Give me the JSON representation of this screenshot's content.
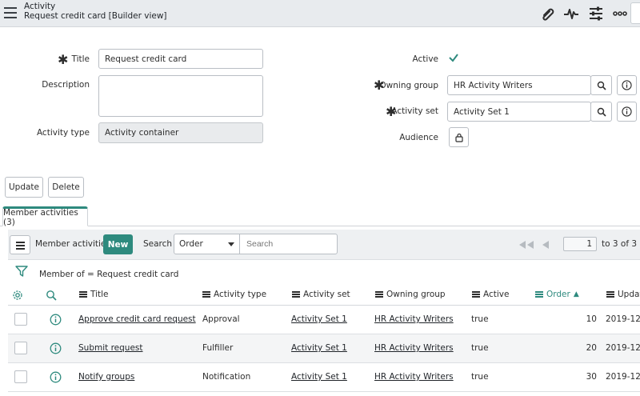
{
  "header": {
    "title": "Activity",
    "subtitle": "Request credit card [Builder view]",
    "icons": [
      "paperclip-icon",
      "activity-pulse-icon",
      "sliders-icon",
      "more-icon"
    ]
  },
  "form": {
    "title_label": "Title",
    "title_value": "Request credit card",
    "description_label": "Description",
    "description_value": "",
    "activity_type_label": "Activity type",
    "activity_type_value": "Activity container",
    "active_label": "Active",
    "active_checked": true,
    "owning_group_label": "Owning group",
    "owning_group_value": "HR Activity Writers",
    "activity_set_label": "Activity set",
    "activity_set_value": "Activity Set 1",
    "audience_label": "Audience"
  },
  "actions": {
    "update_label": "Update",
    "delete_label": "Delete"
  },
  "tabs": [
    {
      "label": "Member activities (3)",
      "active": true
    }
  ],
  "list": {
    "title": "Member activities",
    "new_label": "New",
    "search_label": "Search",
    "search_field": "Order",
    "search_placeholder": "Search",
    "page_current": "1",
    "page_of": "to 3 of 3",
    "filter_text": "Member of = Request credit card",
    "columns": {
      "title": "Title",
      "activity_type": "Activity type",
      "activity_set": "Activity set",
      "owning_group": "Owning group",
      "active": "Active",
      "order": "Order",
      "updated": "Updat"
    },
    "rows": [
      {
        "title": "Approve credit card request",
        "activity_type": "Approval",
        "activity_set": "Activity Set 1",
        "owning_group": "HR Activity Writers",
        "active": "true",
        "order": "10",
        "updated": "2019-12-1"
      },
      {
        "title": "Submit request",
        "activity_type": "Fulfiller",
        "activity_set": "Activity Set 1",
        "owning_group": "HR Activity Writers",
        "active": "true",
        "order": "20",
        "updated": "2019-12-1"
      },
      {
        "title": "Notify groups",
        "activity_type": "Notification",
        "activity_set": "Activity Set 1",
        "owning_group": "HR Activity Writers",
        "active": "true",
        "order": "30",
        "updated": "2019-12-1"
      }
    ]
  },
  "colors": {
    "accent": "#2e8a7e",
    "header_bg": "#e8ebee"
  }
}
